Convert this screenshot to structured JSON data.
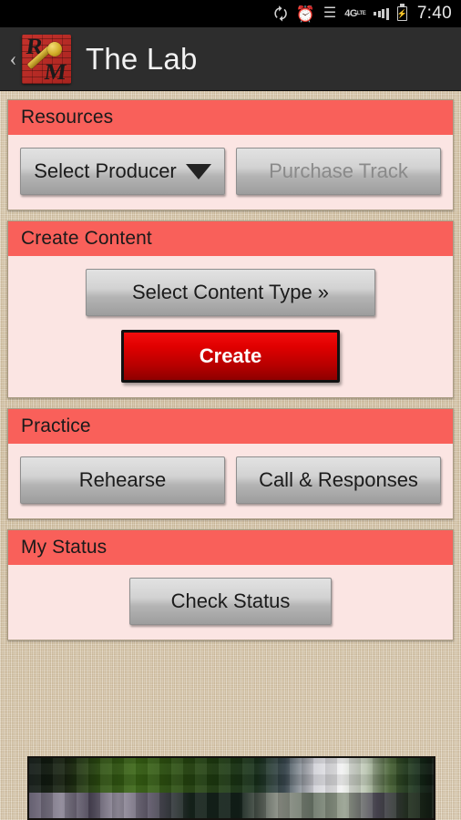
{
  "status_bar": {
    "bluetooth_icon": "bluetooth-icon",
    "alarm_icon": "alarm-clock-icon",
    "wifi_icon": "wifi-icon",
    "network_label": "4G",
    "network_sub": "LTE",
    "signal_icon": "signal-bars-icon",
    "battery_icon": "battery-charging-icon",
    "battery_glyph": "⚡",
    "time": "7:40"
  },
  "action_bar": {
    "back_label": "‹",
    "logo_name": "app-logo-microphone",
    "logo_letter_r": "R",
    "logo_letter_m": "M",
    "title": "The Lab"
  },
  "sections": {
    "resources": {
      "header": "Resources",
      "select_producer_label": "Select Producer",
      "purchase_track_label": "Purchase Track",
      "purchase_track_enabled": false
    },
    "create_content": {
      "header": "Create Content",
      "select_content_type_label": "Select Content Type »",
      "create_label": "Create"
    },
    "practice": {
      "header": "Practice",
      "rehearse_label": "Rehearse",
      "call_responses_label": "Call & Responses"
    },
    "my_status": {
      "header": "My Status",
      "check_status_label": "Check Status"
    }
  },
  "bottom_banner": {
    "name": "advertisement-banner"
  },
  "colors": {
    "section_header_red": "#f9605a",
    "panel_body_pink": "#fbe5e3",
    "create_button_red": "#e00000",
    "action_bar_gray": "#2d2d2d",
    "background_tan": "#d7c5a8",
    "disabled_text_gray": "#8a8a8a"
  }
}
